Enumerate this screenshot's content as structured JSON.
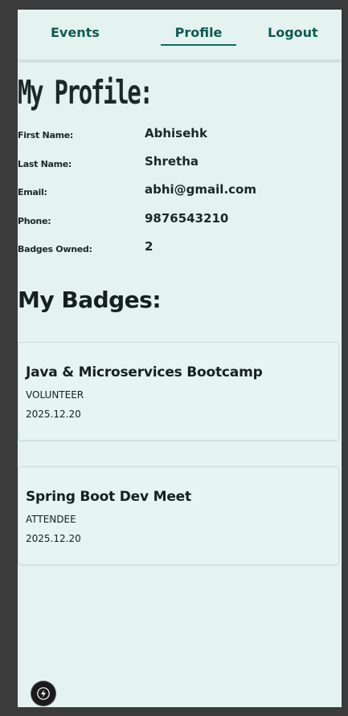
{
  "nav": {
    "events": "Events",
    "profile": "Profile",
    "logout": "Logout",
    "active": "Profile",
    "accent_color": "#0e6b62"
  },
  "profile": {
    "title": "My Profile:",
    "fields": [
      {
        "label": "First Name:",
        "value": "Abhisehk"
      },
      {
        "label": "Last Name:",
        "value": "Shretha"
      },
      {
        "label": "Email:",
        "value": "abhi@gmail.com"
      },
      {
        "label": "Phone:",
        "value": "9876543210"
      },
      {
        "label": "Badges Owned:",
        "value": "2"
      }
    ]
  },
  "badges": {
    "title": "My Badges:",
    "items": [
      {
        "name": "Java & Microservices Bootcamp",
        "role": "VOLUNTEER",
        "date": "2025.12.20"
      },
      {
        "name": "Spring Boot Dev Meet",
        "role": "ATTENDEE",
        "date": "2025.12.20"
      }
    ]
  },
  "dev_tools": {
    "icon": "lightning-bolt-icon"
  },
  "colors": {
    "background": "#e4f3f0",
    "frame": "#3b3b3b",
    "text": "#1a2927",
    "nav_text": "#0e5a52"
  }
}
